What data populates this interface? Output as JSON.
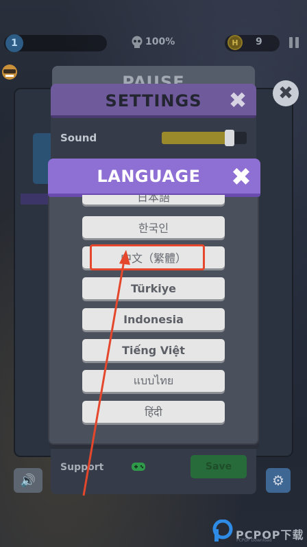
{
  "hud": {
    "level": "1",
    "progress": "100%",
    "coin_symbol": "H",
    "coins": "9"
  },
  "pause": {
    "title": "PAUSE",
    "close_symbol": "✖",
    "speaker_icon": "speaker-icon",
    "settings_icon": "gear-icon"
  },
  "settings": {
    "title": "SETTINGS",
    "close_symbol": "✖",
    "sound_label": "Sound",
    "sound_level": 0.8,
    "support_label": "Support",
    "support_icon": "gamepad-icon",
    "save_label": "Save"
  },
  "language": {
    "title": "LANGUAGE",
    "close_symbol": "✖",
    "options": [
      {
        "label": "日本語"
      },
      {
        "label": "한국인"
      },
      {
        "label": "中文（繁體）"
      },
      {
        "label": "Türkiye"
      },
      {
        "label": "Indonesia"
      },
      {
        "label": "Tiếng Việt"
      },
      {
        "label": "แบบไทย"
      },
      {
        "label": "हिंदी"
      }
    ],
    "highlighted": "中文（繁體）"
  },
  "colors": {
    "language_header": "#8e6fd4",
    "settings_header": "#6f5a9c",
    "highlight": "#e4472c"
  },
  "watermark": {
    "text": "PCPOP下载",
    "sub": "PCPOP Download"
  }
}
